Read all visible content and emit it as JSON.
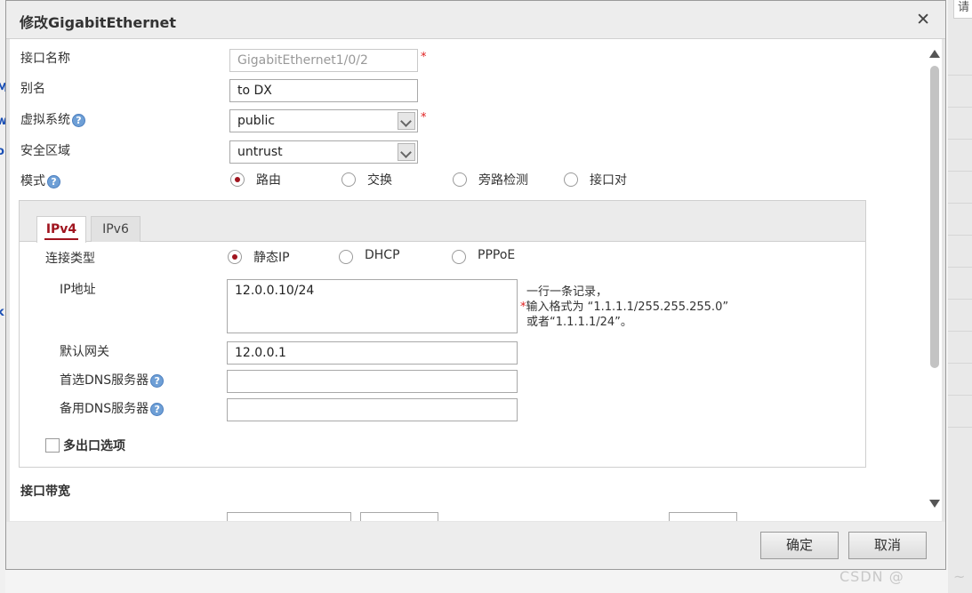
{
  "background": {
    "right_edge_text": "请"
  },
  "dialog": {
    "title": "修改GigabitEthernet",
    "close_icon": "close-icon",
    "fields": {
      "interface_name_label": "接口名称",
      "interface_name_value": "GigabitEthernet1/0/2",
      "alias_label": "别名",
      "alias_value": "to DX",
      "vsys_label": "虚拟系统",
      "vsys_value": "public",
      "zone_label": "安全区域",
      "zone_value": "untrust",
      "mode_label": "模式",
      "mode_options": [
        "路由",
        "交换",
        "旁路检测",
        "接口对"
      ],
      "mode_selected": "路由",
      "required_mark": "*",
      "help_glyph": "?"
    },
    "tabs": [
      {
        "label": "IPv4",
        "active": true
      },
      {
        "label": "IPv6",
        "active": false
      }
    ],
    "ipv4": {
      "conn_type_label": "连接类型",
      "conn_type_options": [
        "静态IP",
        "DHCP",
        "PPPoE"
      ],
      "conn_type_selected": "静态IP",
      "ip_label": "IP地址",
      "ip_value": "12.0.0.10/24",
      "hint_line1": "一行一条记录，",
      "hint_line2": "输入格式为 “1.1.1.1/255.255.255.0”",
      "hint_line3": "或者“1.1.1.1/24”。",
      "gateway_label": "默认网关",
      "gateway_value": "12.0.0.1",
      "dns1_label": "首选DNS服务器",
      "dns1_value": "",
      "dns2_label": "备用DNS服务器",
      "dns2_value": "",
      "multi_exit_label": "多出口选项",
      "multi_exit_checked": false
    },
    "bandwidth_label": "接口带宽",
    "buttons": {
      "ok": "确定",
      "cancel": "取消"
    }
  },
  "watermark": {
    "text": "CSDN @",
    "tail": "~"
  },
  "colors": {
    "accent": "#a0141e",
    "help_icon": "#6e9fd6",
    "required": "#e02020"
  }
}
